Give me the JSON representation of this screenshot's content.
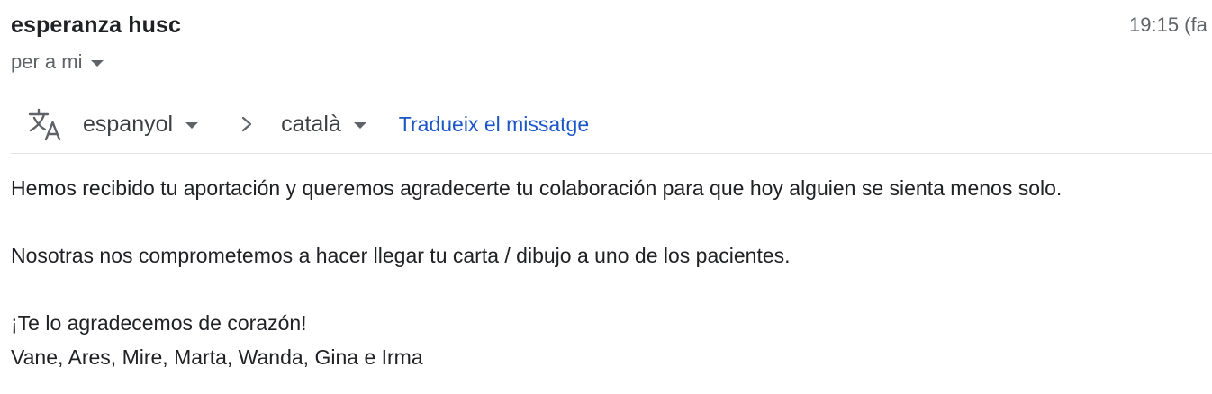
{
  "email": {
    "sender_name": "esperanza husc",
    "time": "19:15 (fa",
    "recipient": "per a mi"
  },
  "translate_bar": {
    "icon": "translate-icon",
    "source_language": "espanyol",
    "target_language": "català",
    "translate_label": "Tradueix el missatge",
    "link_color": "#1a56c8"
  },
  "message": {
    "lines": [
      "Hemos recibido tu aportación y queremos agradecerte tu colaboración para que hoy alguien se sienta menos solo.",
      "Nosotras nos comprometemos a hacer llegar tu carta / dibujo a uno de los pacientes.",
      "¡Te lo agradecemos de corazón!",
      "Vane, Ares, Mire, Marta, Wanda, Gina e Irma"
    ]
  }
}
